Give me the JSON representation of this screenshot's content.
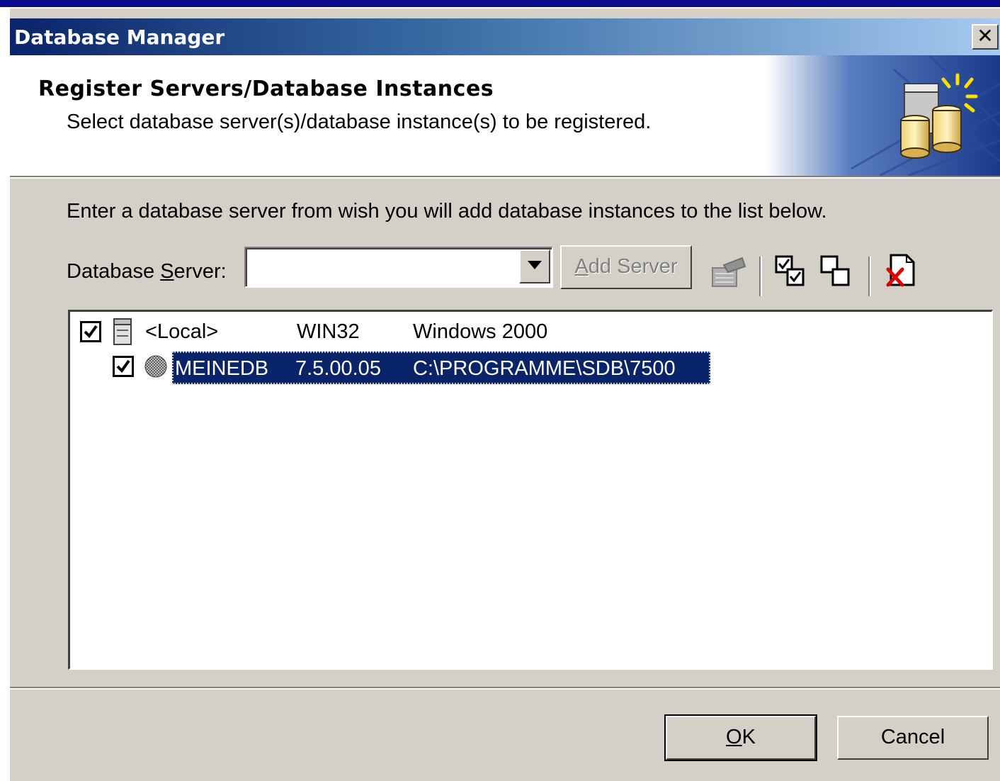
{
  "window": {
    "title": "Database Manager",
    "close_glyph": "✕"
  },
  "header": {
    "title": "Register Servers/Database Instances",
    "subtitle": "Select database server(s)/database instance(s) to be registered.",
    "art_icon": "database-servers-icon"
  },
  "main": {
    "instruction": "Enter a database server from wish you will add database instances to the list below.",
    "server_label_prefix": "Database ",
    "server_label_mnemonic": "S",
    "server_label_suffix": "erver:",
    "server_value": "",
    "add_server_mnemonic": "A",
    "add_server_rest": "dd Server",
    "toolbar_icons": [
      "server-properties-icon",
      "select-all-icon",
      "deselect-all-icon",
      "delete-icon"
    ]
  },
  "list": {
    "rows": [
      {
        "checked": true,
        "icon": "server-icon",
        "name": "<Local>",
        "version": "WIN32",
        "path": "Windows 2000",
        "selected": false
      },
      {
        "checked": true,
        "icon": "database-instance-icon",
        "name": "MEINEDB",
        "version": "7.5.00.05",
        "path": "C:\\PROGRAMME\\SDB\\7500",
        "selected": true
      }
    ]
  },
  "footer": {
    "ok_mnemonic": "O",
    "ok_rest": "K",
    "cancel_label": "Cancel"
  },
  "colors": {
    "selection": "#0a246a",
    "face": "#d4d0c8",
    "title_start": "#0a246a",
    "title_end": "#a6caf0"
  }
}
